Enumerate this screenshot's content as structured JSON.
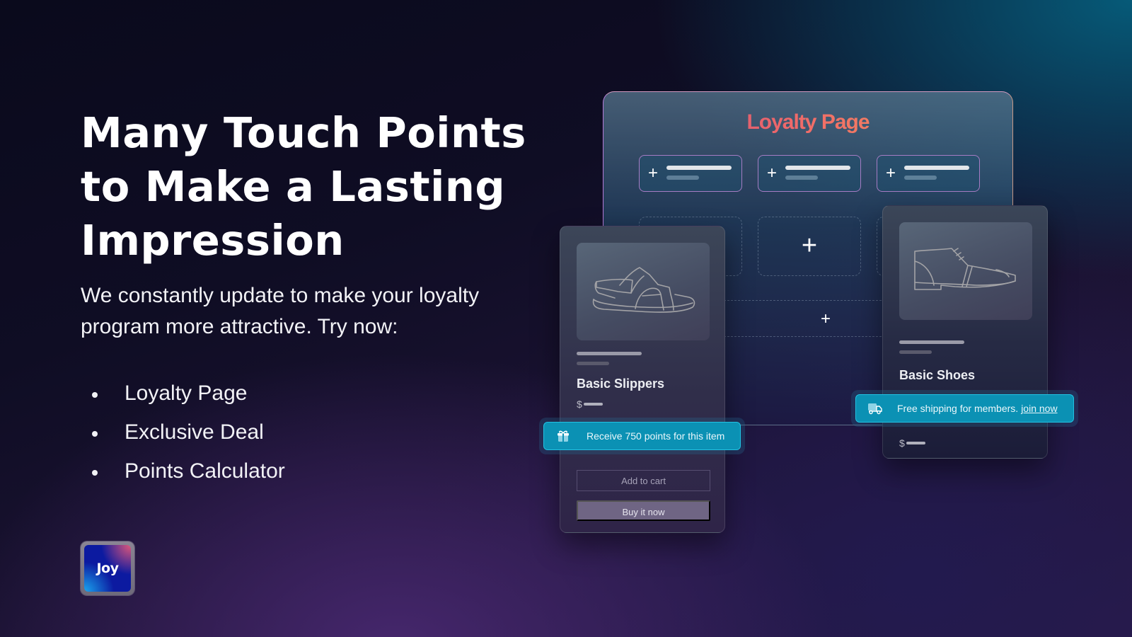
{
  "hero": {
    "title": "Many Touch Points to Make a Lasting Impression",
    "subtitle": "We constantly update to make your loyalty program more attractive. Try now:",
    "features": [
      "Loyalty Page",
      "Exclusive Deal",
      "Points Calculator"
    ]
  },
  "logo": {
    "text": "Joy"
  },
  "loyalty_panel": {
    "title": "Loyalty Page",
    "tile_icon": "plus-icon",
    "tile_count": 3
  },
  "products": [
    {
      "name": "Basic Slippers",
      "currency": "$",
      "icon": "sandal-icon",
      "banner": {
        "icon": "gift-icon",
        "text": "Receive 750 points for this item"
      },
      "buttons": {
        "add_to_cart": "Add to cart",
        "buy_now": "Buy it now"
      }
    },
    {
      "name": "Basic Shoes",
      "currency": "$",
      "icon": "shoe-icon",
      "banner": {
        "icon": "truck-icon",
        "text": "Free shipping for members.",
        "link": "join now"
      }
    }
  ],
  "colors": {
    "banner": "#0b91b4",
    "banner_border": "#22c2e2",
    "title_gradient_start": "#b5497a",
    "title_gradient_end": "#f59a56",
    "logo_bg": "#0c1aa0"
  }
}
